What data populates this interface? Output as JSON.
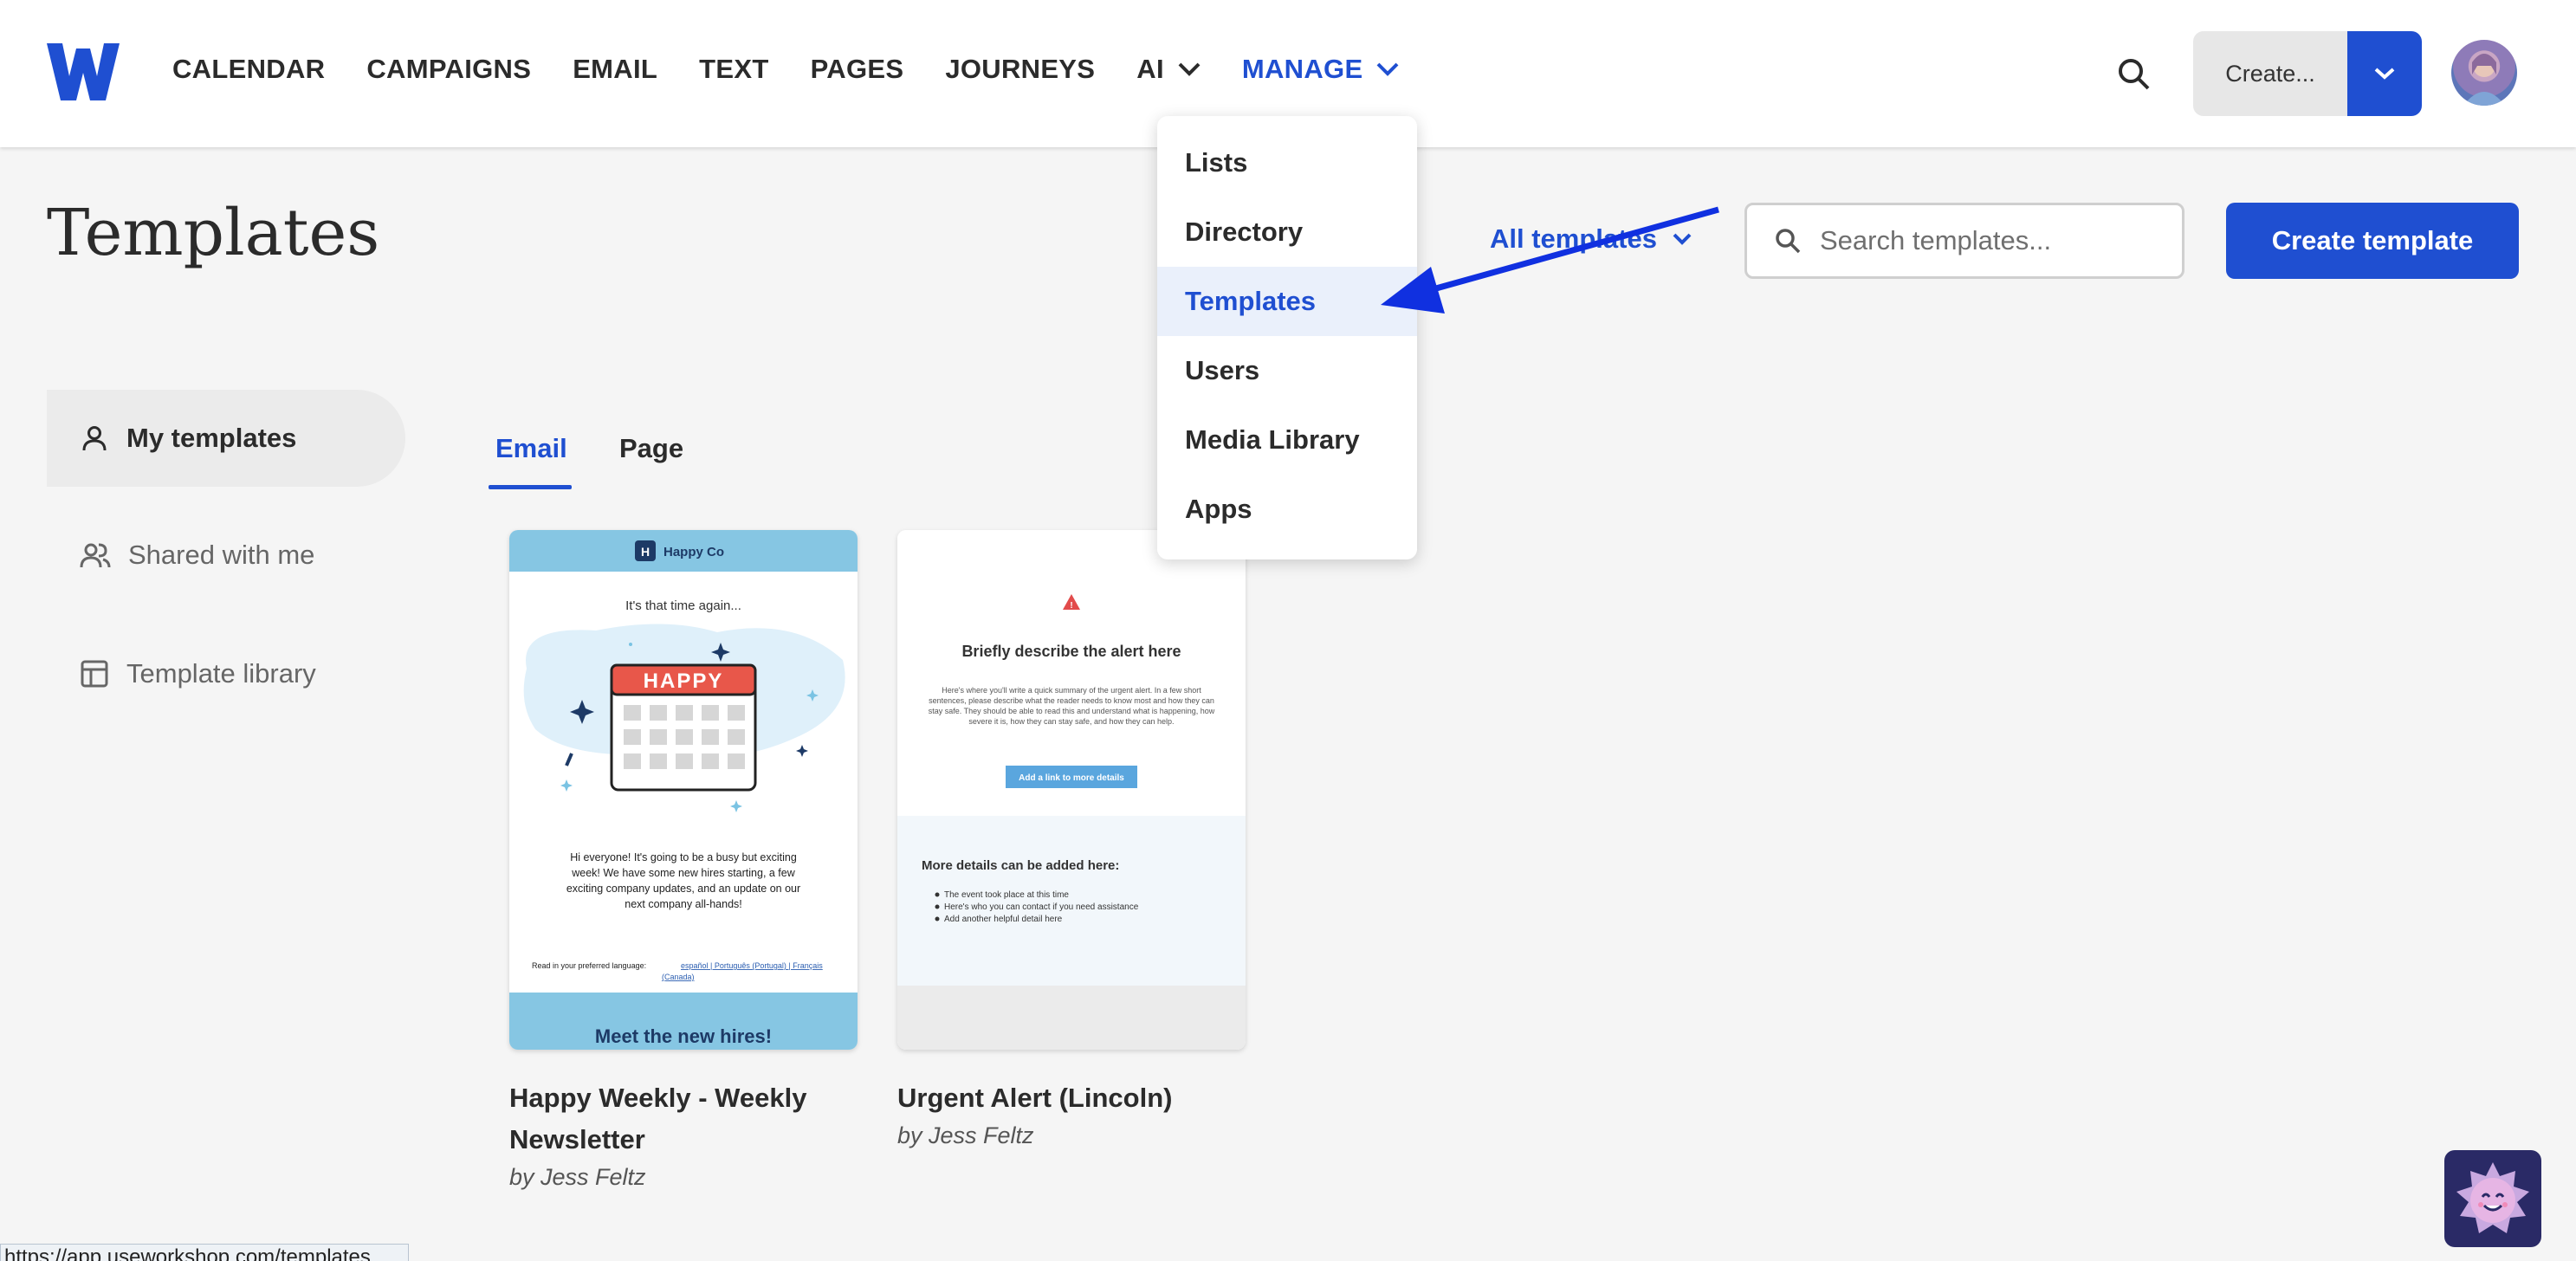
{
  "nav": {
    "items": [
      "CALENDAR",
      "CAMPAIGNS",
      "EMAIL",
      "TEXT",
      "PAGES",
      "JOURNEYS"
    ],
    "ai_label": "AI",
    "manage_label": "MANAGE"
  },
  "header": {
    "create_label": "Create..."
  },
  "page": {
    "title": "Templates",
    "filter_label": "All templates",
    "search_placeholder": "Search templates...",
    "create_template_label": "Create template"
  },
  "sidebar": {
    "items": [
      {
        "label": "My templates",
        "icon": "person-icon",
        "active": true
      },
      {
        "label": "Shared with me",
        "icon": "people-icon",
        "active": false
      },
      {
        "label": "Template library",
        "icon": "layout-icon",
        "active": false
      }
    ]
  },
  "tabs": [
    {
      "label": "Email",
      "active": true
    },
    {
      "label": "Page",
      "active": false
    }
  ],
  "cards": [
    {
      "title_line1": "Happy Weekly - Weekly",
      "title_line2": "Newsletter",
      "author": "by Jess Feltz",
      "preview": {
        "brand": "Happy Co",
        "intro": "It's that time again...",
        "calendar_word": "HAPPY",
        "body_l1": "Hi everyone! It's going to be a busy but exciting",
        "body_l2": "week! We have some new hires starting, a few",
        "body_l3": "exciting company updates, and an update on our",
        "body_l4": "next company all-hands!",
        "lang_label": "Read in your preferred language:",
        "lang_links": "español | Português (Portugal) | Français",
        "lang_links2": "(Canada)",
        "footer": "Meet the new hires!"
      }
    },
    {
      "title": "Urgent Alert (Lincoln)",
      "author": "by Jess Feltz",
      "preview": {
        "heading": "Briefly describe the alert here",
        "para_l1": "Here's where you'll write a quick summary of the urgent alert. In a few short",
        "para_l2": "sentences, please describe what the reader needs to know most and how they can",
        "para_l3": "stay safe. They should be able to read this and understand what is happening, how",
        "para_l4": "severe it is, how they can stay safe, and how they can help.",
        "button": "Add a link to more details",
        "more_heading": "More details can be added here:",
        "bullets": [
          "The event took place at this time",
          "Here's who you can contact if you need assistance",
          "Add another helpful detail here"
        ]
      }
    }
  ],
  "dropdown": {
    "items": [
      "Lists",
      "Directory",
      "Templates",
      "Users",
      "Media Library",
      "Apps"
    ],
    "highlighted": "Templates"
  },
  "status_url": "https://app.useworkshop.com/templates",
  "colors": {
    "brand_blue": "#1f4fd1",
    "arrow_blue": "#1030e0",
    "background": "#f5f5f5"
  }
}
